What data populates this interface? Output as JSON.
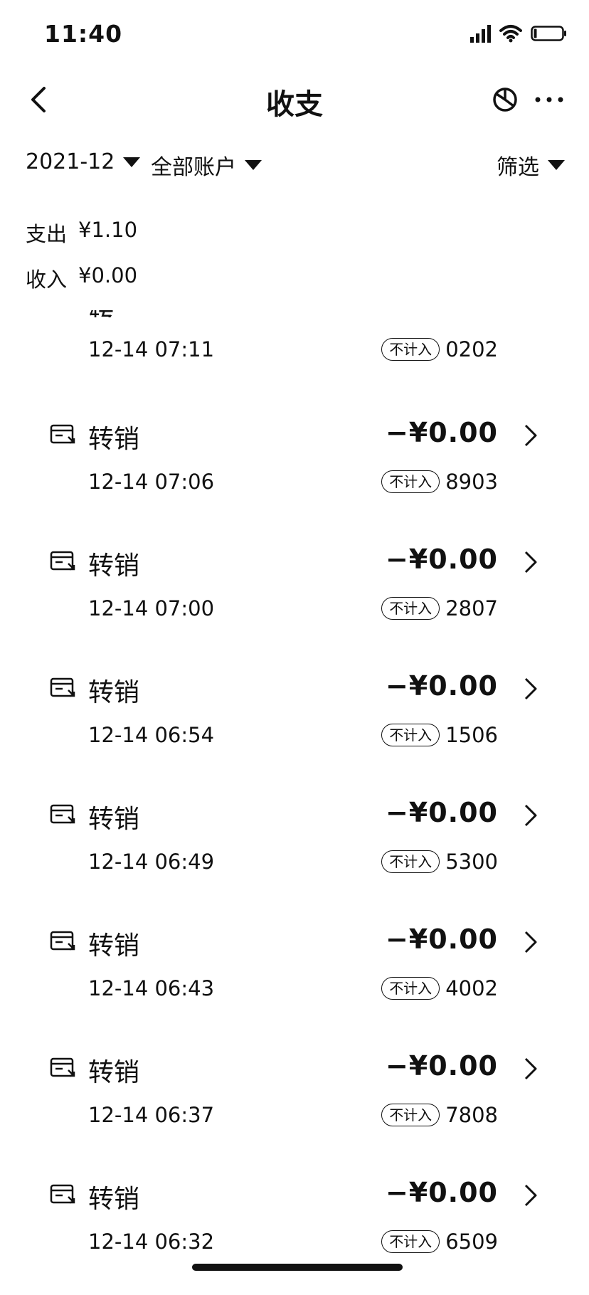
{
  "status_bar": {
    "time": "11:40"
  },
  "nav": {
    "title": "收支"
  },
  "filters": {
    "month": "2021-12",
    "account": "全部账户",
    "filter": "筛选"
  },
  "summary": {
    "expense_label": "支出",
    "expense_value": "¥1.10",
    "income_label": "收入",
    "income_value": "¥0.00"
  },
  "partial_row": {
    "datetime": "12-14 07:11",
    "tag": "不计入",
    "code": "0202"
  },
  "transactions": [
    {
      "name": "转销",
      "amount": "−¥0.00",
      "datetime": "12-14 07:06",
      "tag": "不计入",
      "code": "8903"
    },
    {
      "name": "转销",
      "amount": "−¥0.00",
      "datetime": "12-14 07:00",
      "tag": "不计入",
      "code": "2807"
    },
    {
      "name": "转销",
      "amount": "−¥0.00",
      "datetime": "12-14 06:54",
      "tag": "不计入",
      "code": "1506"
    },
    {
      "name": "转销",
      "amount": "−¥0.00",
      "datetime": "12-14 06:49",
      "tag": "不计入",
      "code": "5300"
    },
    {
      "name": "转销",
      "amount": "−¥0.00",
      "datetime": "12-14 06:43",
      "tag": "不计入",
      "code": "4002"
    },
    {
      "name": "转销",
      "amount": "−¥0.00",
      "datetime": "12-14 06:37",
      "tag": "不计入",
      "code": "7808"
    },
    {
      "name": "转销",
      "amount": "−¥0.00",
      "datetime": "12-14 06:32",
      "tag": "不计入",
      "code": "6509"
    }
  ],
  "icons": {
    "back": "chevron-left-icon",
    "chart": "pie-chart-icon",
    "more": "more-dots-icon",
    "dropdown": "caret-down-icon",
    "transaction": "card-transfer-icon",
    "row_arrow": "chevron-right-icon",
    "signal": "signal-icon",
    "wifi": "wifi-icon",
    "battery": "battery-icon"
  }
}
